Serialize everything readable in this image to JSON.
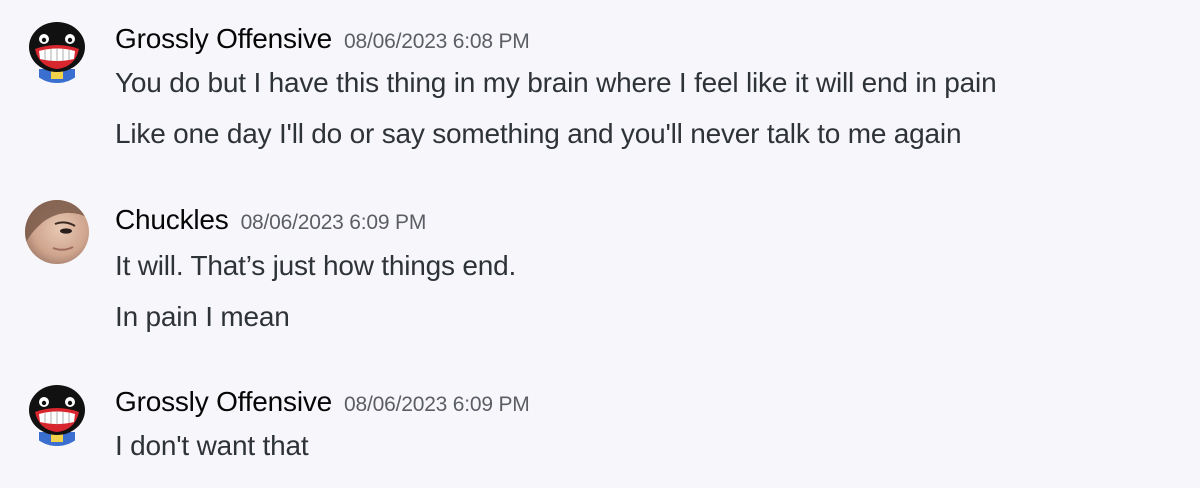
{
  "messages": [
    {
      "author": "Grossly Offensive",
      "timestamp": "08/06/2023 6:08 PM",
      "avatar_icon": "grinning-face-avatar",
      "lines": [
        "You do but I have this thing in my brain where I feel like it will end in pain",
        "Like one day I'll do or say something and you'll never talk to me again"
      ]
    },
    {
      "author": "Chuckles",
      "timestamp": "08/06/2023 6:09 PM",
      "avatar_icon": "face-photo-avatar",
      "lines": [
        "It will. That’s just how things end.",
        "In pain I mean"
      ]
    },
    {
      "author": "Grossly Offensive",
      "timestamp": "08/06/2023 6:09 PM",
      "avatar_icon": "grinning-face-avatar",
      "lines": [
        "I don't want that"
      ]
    }
  ],
  "colors": {
    "background": "#f7f7fb",
    "username": "#060607",
    "timestamp": "#5c5e66",
    "message_text": "#2e3338"
  }
}
